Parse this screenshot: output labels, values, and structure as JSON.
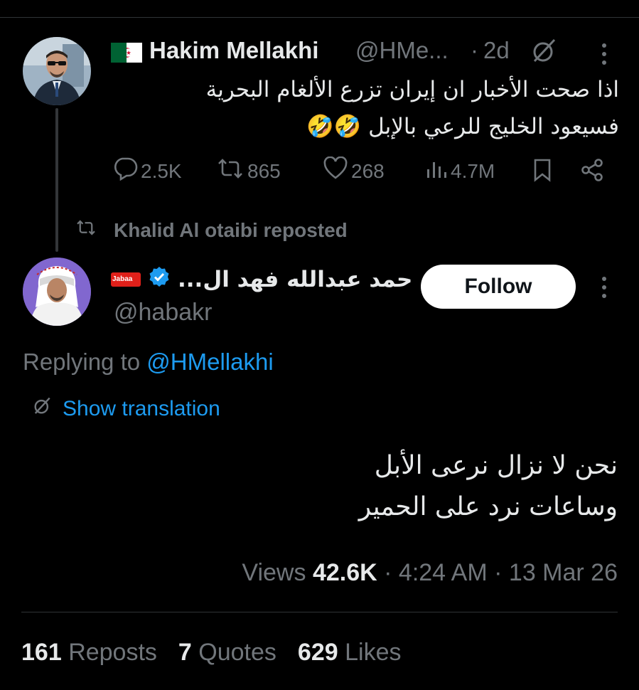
{
  "original_tweet": {
    "author_name": "Hakim Mellakhi",
    "author_flag": "algeria-flag",
    "handle": "@HMe...",
    "separator": "·",
    "time_ago": "2d",
    "text_lines": [
      "اذا صحت الأخبار ان إيران تزرع الألغام البحرية",
      "فسيعود الخليج للرعي بالإبل 🤣🤣"
    ],
    "actions": {
      "replies": "2.5K",
      "reposts": "865",
      "likes": "268",
      "views": "4.7M"
    }
  },
  "repost_banner": {
    "text": "Khalid Al otaibi reposted"
  },
  "reply_tweet": {
    "author_name": "حمد عبدالله فهد ال...",
    "badge_text": "Jabaa",
    "handle": "@habakr",
    "follow_label": "Follow",
    "replying_prefix": "Replying to",
    "replying_to": "@HMellakhi",
    "translate_label": "Show translation",
    "text_lines": [
      "نحن لا نزال نرعى الأبل",
      "وساعات نرد على الحمير"
    ],
    "views_label": "Views",
    "views_count": "42.6K",
    "time": "4:24 AM",
    "date": "13 Mar 26",
    "reposts_count": "161",
    "reposts_label": "Reposts",
    "quotes_count": "7",
    "quotes_label": "Quotes",
    "likes_count": "629",
    "likes_label": "Likes"
  },
  "colors": {
    "background": "#000000",
    "text": "#e7e9ea",
    "muted": "#71767b",
    "link": "#1d9bf0",
    "verified": "#1d9bf0",
    "divider": "#2f3336"
  }
}
